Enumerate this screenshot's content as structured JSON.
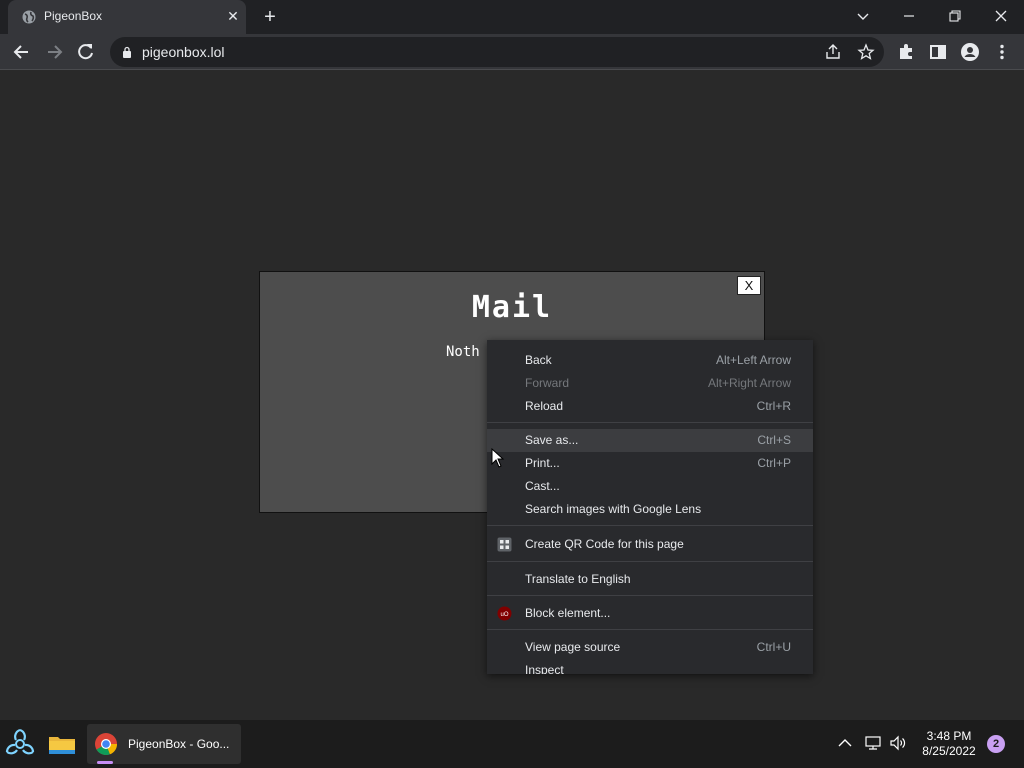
{
  "browser": {
    "tab": {
      "title": "PigeonBox",
      "close_icon": "close-icon"
    },
    "new_tab_label": "+",
    "window_controls": {
      "tab_search": "chevron-down-icon",
      "minimize": "minimize-icon",
      "restore": "restore-icon",
      "close": "close-icon"
    },
    "address": {
      "url": "pigeonbox.lol"
    }
  },
  "modal": {
    "title": "Mail",
    "text": "Noth",
    "close_label": "X"
  },
  "context_menu": {
    "items": [
      {
        "label": "Back",
        "shortcut": "Alt+Left Arrow",
        "disabled": false
      },
      {
        "label": "Forward",
        "shortcut": "Alt+Right Arrow",
        "disabled": true
      },
      {
        "label": "Reload",
        "shortcut": "Ctrl+R",
        "disabled": false
      },
      {
        "label": "Save as...",
        "shortcut": "Ctrl+S",
        "disabled": false,
        "highlighted": true
      },
      {
        "label": "Print...",
        "shortcut": "Ctrl+P",
        "disabled": false
      },
      {
        "label": "Cast...",
        "shortcut": "",
        "disabled": false
      },
      {
        "label": "Search images with Google Lens",
        "shortcut": "",
        "disabled": false
      },
      {
        "label": "Create QR Code for this page",
        "shortcut": "",
        "icon": "qr-code-icon"
      },
      {
        "label": "Translate to English",
        "shortcut": ""
      },
      {
        "label": "Block element...",
        "shortcut": "",
        "icon": "ublock-origin-icon",
        "icon_text": "uO"
      },
      {
        "label": "View page source",
        "shortcut": "Ctrl+U"
      },
      {
        "label": "Inspect",
        "shortcut": ""
      }
    ]
  },
  "taskbar": {
    "chrome_label": "PigeonBox - Goo...",
    "clock": {
      "time": "3:48 PM",
      "date": "8/25/2022"
    },
    "notification_count": "2"
  },
  "colors": {
    "page_bg": "#292929",
    "modal_bg": "#4d4d4d",
    "menu_bg": "#292a2d",
    "menu_highlight": "#3c3d40",
    "accent_purple": "#c78ef5"
  }
}
